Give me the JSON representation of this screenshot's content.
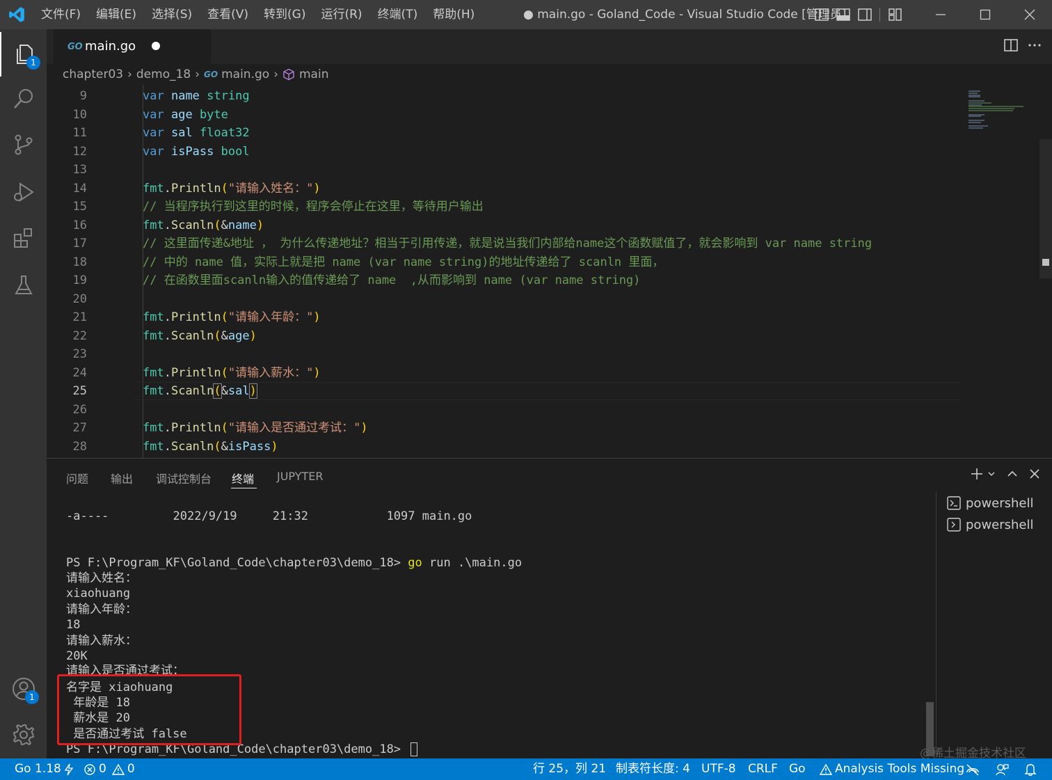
{
  "titlebar": {
    "menus": [
      "文件(F)",
      "编辑(E)",
      "选择(S)",
      "查看(V)",
      "转到(G)",
      "运行(R)",
      "终端(T)",
      "帮助(H)"
    ],
    "window_title": "● main.go - Goland_Code - Visual Studio Code [管理员]"
  },
  "activitybar": {
    "explorer_badge": "1",
    "accounts_badge": "1"
  },
  "tabs": {
    "active": {
      "icon": "GO",
      "label": "main.go"
    }
  },
  "breadcrumb": {
    "items": [
      "chapter03",
      "demo_18",
      "main.go",
      "main"
    ],
    "go_icon": "GO"
  },
  "editor": {
    "line_numbers": [
      "9",
      "10",
      "11",
      "12",
      "13",
      "14",
      "15",
      "16",
      "17",
      "18",
      "19",
      "20",
      "21",
      "22",
      "23",
      "24",
      "25",
      "26",
      "27",
      "28"
    ],
    "active_line": "25",
    "lines": [
      [
        [
          "kw",
          "var"
        ],
        [
          "pl",
          " "
        ],
        [
          "id",
          "name"
        ],
        [
          "pl",
          " "
        ],
        [
          "ty",
          "string"
        ]
      ],
      [
        [
          "kw",
          "var"
        ],
        [
          "pl",
          " "
        ],
        [
          "id",
          "age"
        ],
        [
          "pl",
          " "
        ],
        [
          "ty",
          "byte"
        ]
      ],
      [
        [
          "kw",
          "var"
        ],
        [
          "pl",
          " "
        ],
        [
          "id",
          "sal"
        ],
        [
          "pl",
          " "
        ],
        [
          "ty",
          "float32"
        ]
      ],
      [
        [
          "kw",
          "var"
        ],
        [
          "pl",
          " "
        ],
        [
          "id",
          "isPass"
        ],
        [
          "pl",
          " "
        ],
        [
          "ty",
          "bool"
        ]
      ],
      [],
      [
        [
          "ty",
          "fmt"
        ],
        [
          "pl",
          "."
        ],
        [
          "fn",
          "Println"
        ],
        [
          "br",
          "("
        ],
        [
          "str",
          "\"请输入姓名：\""
        ],
        [
          "br",
          ")"
        ]
      ],
      [
        [
          "cm",
          "// 当程序执行到这里的时候，程序会停止在这里，等待用户输出"
        ]
      ],
      [
        [
          "ty",
          "fmt"
        ],
        [
          "pl",
          "."
        ],
        [
          "fn",
          "Scanln"
        ],
        [
          "br",
          "("
        ],
        [
          "pl",
          "&"
        ],
        [
          "id",
          "name"
        ],
        [
          "br",
          ")"
        ]
      ],
      [
        [
          "cm",
          "// 这里面传递&地址 ， 为什么传递地址？相当于引用传递，就是说当我们内部给name这个函数赋值了，就会影响到 var name string"
        ]
      ],
      [
        [
          "cm",
          "// 中的 name 值，实际上就是把 name (var name string)的地址传递给了 scanln 里面，"
        ]
      ],
      [
        [
          "cm",
          "// 在函数里面scanln输入的值传递给了 name  ,从而影响到 name (var name string)"
        ]
      ],
      [],
      [
        [
          "ty",
          "fmt"
        ],
        [
          "pl",
          "."
        ],
        [
          "fn",
          "Println"
        ],
        [
          "br",
          "("
        ],
        [
          "str",
          "\"请输入年龄：\""
        ],
        [
          "br",
          ")"
        ]
      ],
      [
        [
          "ty",
          "fmt"
        ],
        [
          "pl",
          "."
        ],
        [
          "fn",
          "Scanln"
        ],
        [
          "br",
          "("
        ],
        [
          "pl",
          "&"
        ],
        [
          "id",
          "age"
        ],
        [
          "br",
          ")"
        ]
      ],
      [],
      [
        [
          "ty",
          "fmt"
        ],
        [
          "pl",
          "."
        ],
        [
          "fn",
          "Println"
        ],
        [
          "br",
          "("
        ],
        [
          "str",
          "\"请输入薪水：\""
        ],
        [
          "br",
          ")"
        ]
      ],
      [
        [
          "ty",
          "fmt"
        ],
        [
          "pl",
          "."
        ],
        [
          "fn",
          "Scanln"
        ],
        [
          "br",
          "("
        ],
        [
          "pl",
          "&"
        ],
        [
          "id",
          "sal"
        ],
        [
          "br",
          ")"
        ]
      ],
      [],
      [
        [
          "ty",
          "fmt"
        ],
        [
          "pl",
          "."
        ],
        [
          "fn",
          "Println"
        ],
        [
          "br",
          "("
        ],
        [
          "str",
          "\"请输入是否通过考试：\""
        ],
        [
          "br",
          ")"
        ]
      ],
      [
        [
          "ty",
          "fmt"
        ],
        [
          "pl",
          "."
        ],
        [
          "fn",
          "Scanln"
        ],
        [
          "br",
          "("
        ],
        [
          "pl",
          "&"
        ],
        [
          "id",
          "isPass"
        ],
        [
          "br",
          ")"
        ]
      ]
    ]
  },
  "panel": {
    "tabs": [
      "问题",
      "输出",
      "调试控制台",
      "终端",
      "JUPYTER"
    ],
    "active_tab": "终端",
    "terminals": [
      "powershell",
      "powershell"
    ],
    "terminal_lines": [
      "-a----         2022/9/19     21:32           1097 main.go",
      "",
      "",
      "PS F:\\Program_KF\\Goland_Code\\chapter03\\demo_18> ",
      "请输入姓名：",
      "xiaohuang",
      "请输入年龄：",
      "18",
      "请输入薪水：",
      "20K",
      "请输入是否通过考试：",
      "名字是 xiaohuang",
      " 年龄是 18",
      " 薪水是 20",
      " 是否通过考试 false",
      "PS F:\\Program_KF\\Goland_Code\\chapter03\\demo_18> "
    ],
    "command": "go",
    "command_args": " run .\\main.go"
  },
  "watermark": "@稀土掘金技术社区",
  "statusbar": {
    "go_version": "Go 1.18",
    "errors": "0",
    "warnings": "0",
    "cursor_pos": "行 25，列 21",
    "indent": "制表符长度: 4",
    "encoding": "UTF-8",
    "eol": "CRLF",
    "language": "Go",
    "analysis": "Analysis Tools Missing"
  },
  "colors": {
    "accent": "#007acc",
    "highlight_box": "#e02020"
  }
}
